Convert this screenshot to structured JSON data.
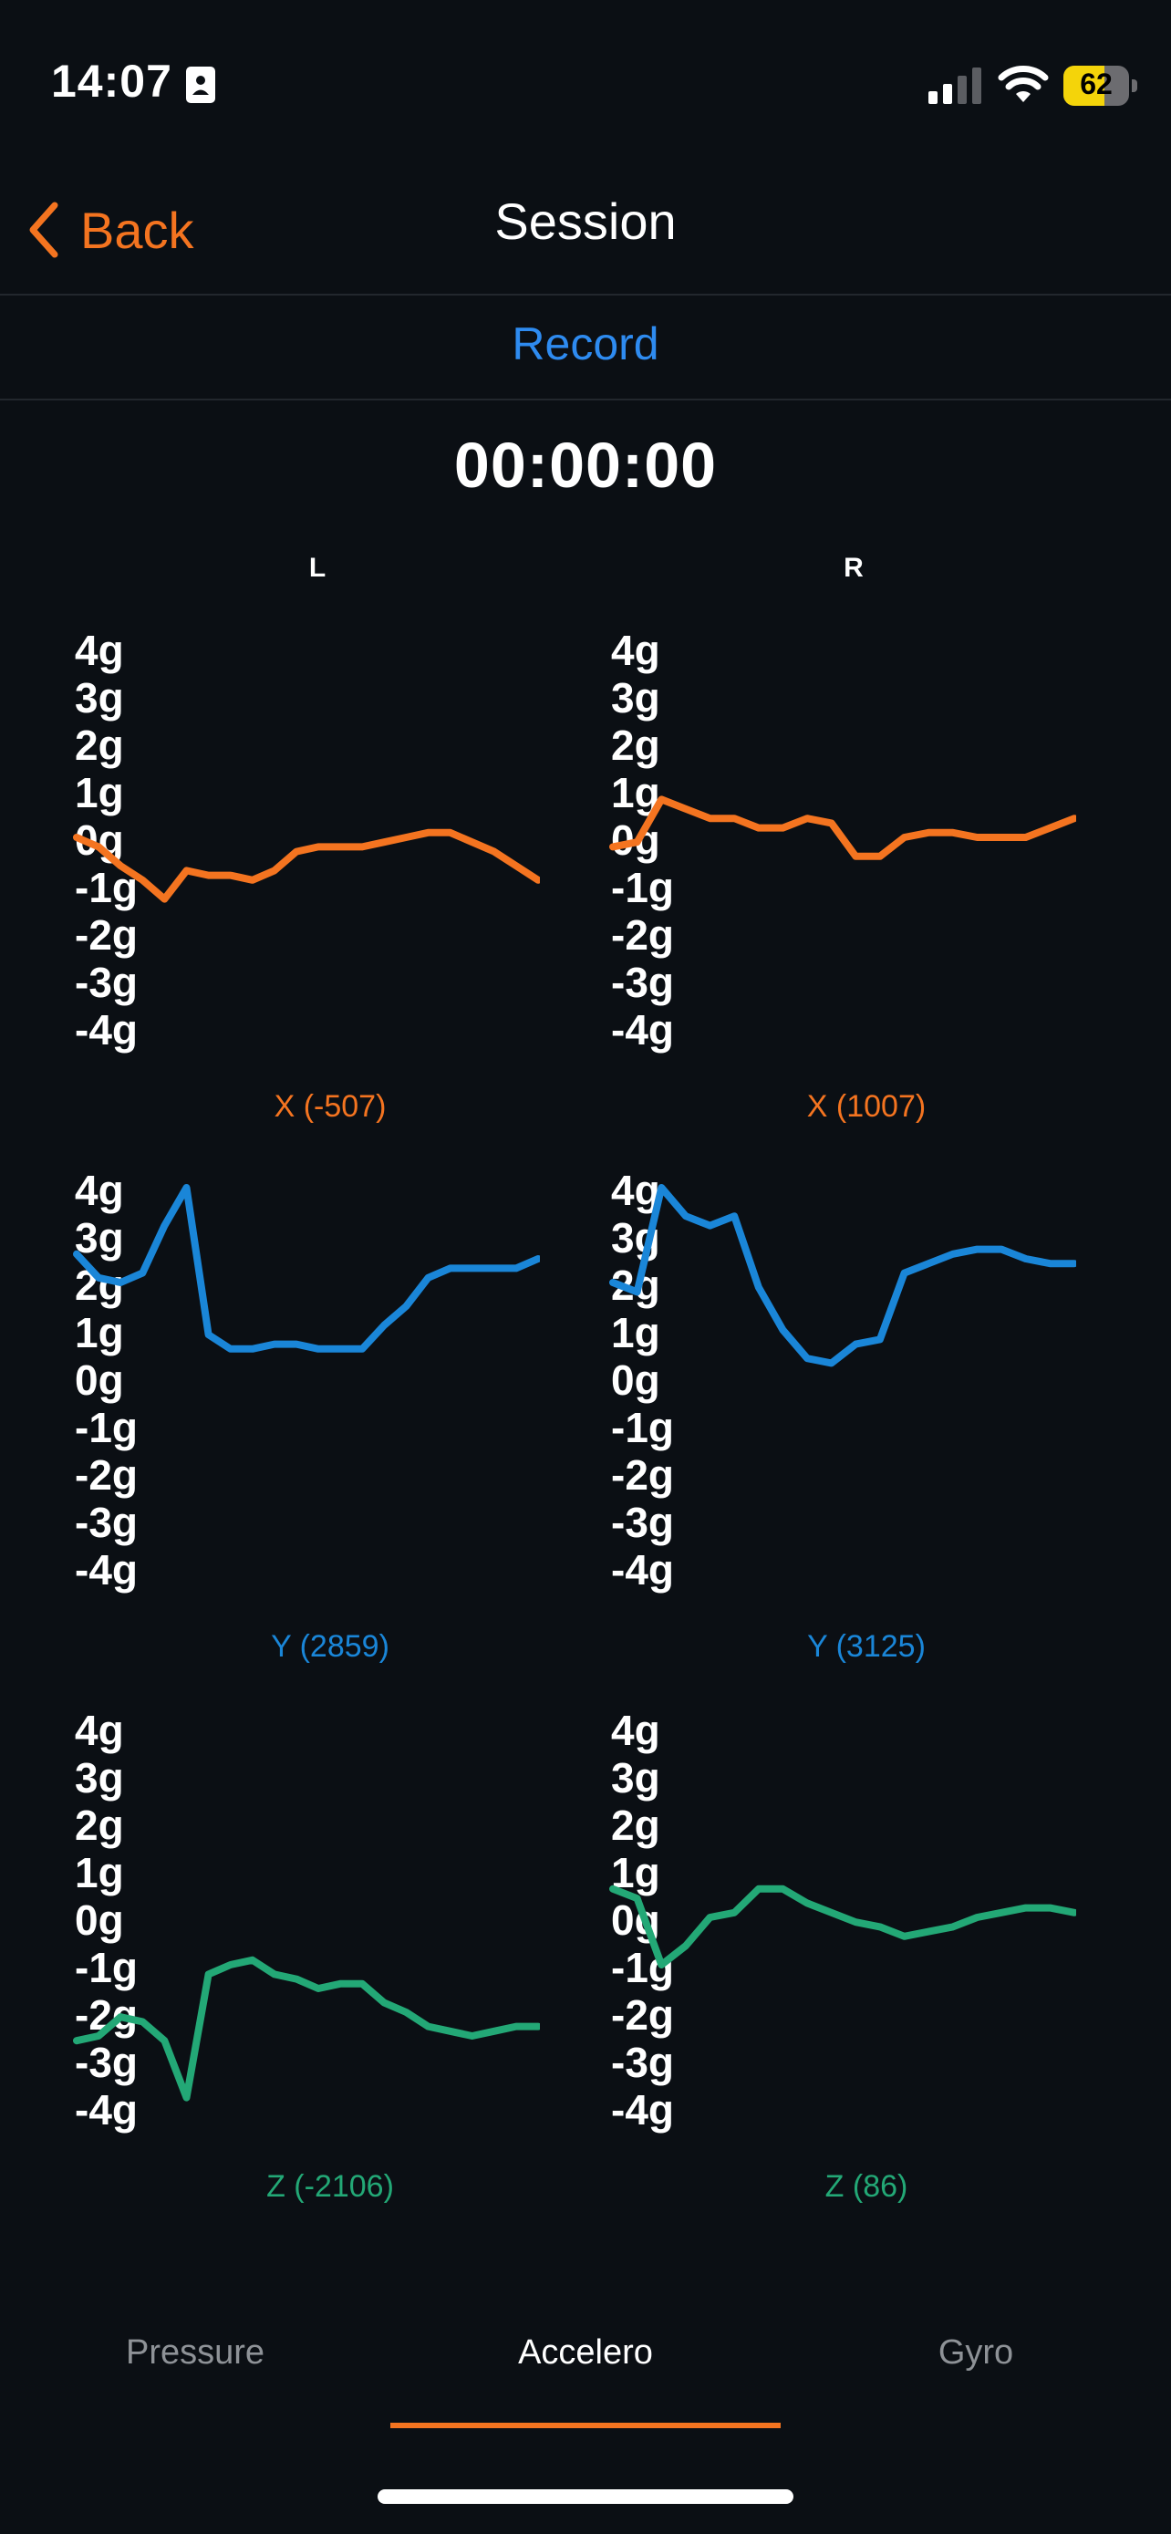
{
  "status_bar": {
    "time": "14:07",
    "battery_level": "62",
    "battery_fraction": 0.62,
    "icons": [
      "id-card-icon",
      "signal-icon",
      "wifi-icon",
      "battery-icon"
    ]
  },
  "nav": {
    "back_label": "Back",
    "title": "Session",
    "back_icon": "chevron-left-icon"
  },
  "record_label": "Record",
  "timer": "00:00:00",
  "columns": [
    "L",
    "R"
  ],
  "colors": {
    "accent": "#f47420",
    "x": "#f47420",
    "y": "#1a86d8",
    "z": "#23a876",
    "link": "#2e8bf0"
  },
  "chart_data": [
    {
      "type": "line",
      "side": "L",
      "axis": "X",
      "caption": "X (-507)",
      "yticks": [
        "4g",
        "3g",
        "2g",
        "1g",
        "0g",
        "-1g",
        "-2g",
        "-3g",
        "-4g"
      ],
      "ylim": [
        -4,
        4
      ],
      "values": [
        0.0,
        -0.2,
        -0.6,
        -0.9,
        -1.3,
        -0.7,
        -0.8,
        -0.8,
        -0.9,
        -0.7,
        -0.3,
        -0.2,
        -0.2,
        -0.2,
        -0.1,
        0.0,
        0.1,
        0.1,
        -0.1,
        -0.3,
        -0.6,
        -0.9
      ]
    },
    {
      "type": "line",
      "side": "R",
      "axis": "X",
      "caption": "X (1007)",
      "yticks": [
        "4g",
        "3g",
        "2g",
        "1g",
        "0g",
        "-1g",
        "-2g",
        "-3g",
        "-4g"
      ],
      "ylim": [
        -4,
        4
      ],
      "values": [
        -0.2,
        -0.1,
        0.8,
        0.6,
        0.4,
        0.4,
        0.2,
        0.2,
        0.4,
        0.3,
        -0.4,
        -0.4,
        0.0,
        0.1,
        0.1,
        0.0,
        0.0,
        0.0,
        0.2,
        0.4
      ]
    },
    {
      "type": "line",
      "side": "L",
      "axis": "Y",
      "caption": "Y (2859)",
      "yticks": [
        "4g",
        "3g",
        "2g",
        "1g",
        "0g",
        "-1g",
        "-2g",
        "-3g",
        "-4g"
      ],
      "ylim": [
        -4,
        4
      ],
      "values": [
        2.6,
        2.1,
        2.0,
        2.2,
        3.2,
        4.0,
        0.9,
        0.6,
        0.6,
        0.7,
        0.7,
        0.6,
        0.6,
        0.6,
        1.1,
        1.5,
        2.1,
        2.3,
        2.3,
        2.3,
        2.3,
        2.5
      ]
    },
    {
      "type": "line",
      "side": "R",
      "axis": "Y",
      "caption": "Y (3125)",
      "yticks": [
        "4g",
        "3g",
        "2g",
        "1g",
        "0g",
        "-1g",
        "-2g",
        "-3g",
        "-4g"
      ],
      "ylim": [
        -4,
        4
      ],
      "values": [
        2.0,
        1.8,
        4.0,
        3.4,
        3.2,
        3.4,
        1.9,
        1.0,
        0.4,
        0.3,
        0.7,
        0.8,
        2.2,
        2.4,
        2.6,
        2.7,
        2.7,
        2.5,
        2.4,
        2.4
      ]
    },
    {
      "type": "line",
      "side": "L",
      "axis": "Z",
      "caption": "Z (-2106)",
      "yticks": [
        "4g",
        "3g",
        "2g",
        "1g",
        "0g",
        "-1g",
        "-2g",
        "-3g",
        "-4g"
      ],
      "ylim": [
        -4,
        4
      ],
      "values": [
        -2.6,
        -2.5,
        -2.1,
        -2.2,
        -2.6,
        -3.8,
        -1.2,
        -1.0,
        -0.9,
        -1.2,
        -1.3,
        -1.5,
        -1.4,
        -1.4,
        -1.8,
        -2.0,
        -2.3,
        -2.4,
        -2.5,
        -2.4,
        -2.3,
        -2.3
      ]
    },
    {
      "type": "line",
      "side": "R",
      "axis": "Z",
      "caption": "Z (86)",
      "yticks": [
        "4g",
        "3g",
        "2g",
        "1g",
        "0g",
        "-1g",
        "-2g",
        "-3g",
        "-4g"
      ],
      "ylim": [
        -4,
        4
      ],
      "values": [
        0.6,
        0.4,
        -1.0,
        -0.6,
        0.0,
        0.1,
        0.6,
        0.6,
        0.3,
        0.1,
        -0.1,
        -0.2,
        -0.4,
        -0.3,
        -0.2,
        0.0,
        0.1,
        0.2,
        0.2,
        0.1
      ]
    }
  ],
  "tabs": [
    {
      "label": "Pressure",
      "active": false
    },
    {
      "label": "Accelero",
      "active": true
    },
    {
      "label": "Gyro",
      "active": false
    }
  ]
}
